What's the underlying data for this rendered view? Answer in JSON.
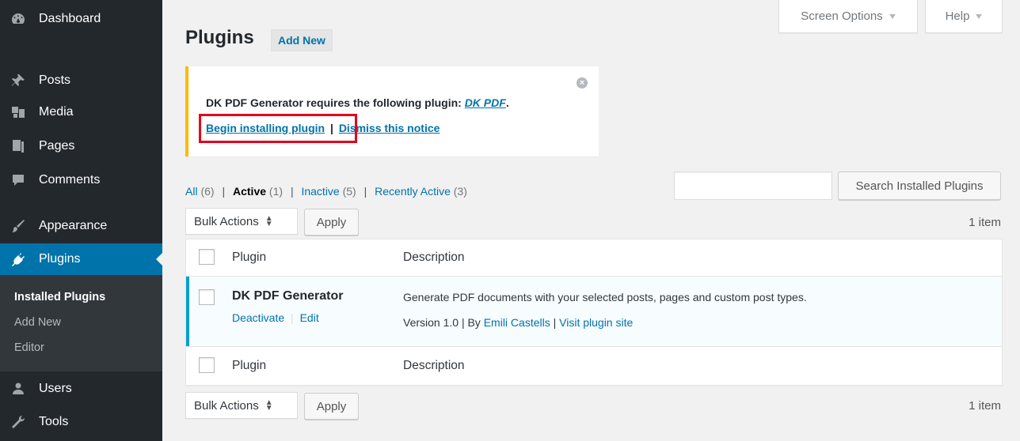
{
  "sidebar": {
    "items": [
      {
        "label": "Dashboard",
        "icon": "dashboard-icon"
      },
      {
        "label": "Posts",
        "icon": "pin-icon"
      },
      {
        "label": "Media",
        "icon": "media-icon"
      },
      {
        "label": "Pages",
        "icon": "pages-icon"
      },
      {
        "label": "Comments",
        "icon": "comment-icon"
      },
      {
        "label": "Appearance",
        "icon": "brush-icon"
      },
      {
        "label": "Plugins",
        "icon": "plugin-icon"
      },
      {
        "label": "Users",
        "icon": "users-icon"
      },
      {
        "label": "Tools",
        "icon": "wrench-icon"
      }
    ],
    "submenu": [
      "Installed Plugins",
      "Add New",
      "Editor"
    ]
  },
  "top_buttons": {
    "screen_options": "Screen Options",
    "help": "Help"
  },
  "header": {
    "title": "Plugins",
    "add_new": "Add New"
  },
  "notice": {
    "text": "DK PDF Generator requires the following plugin: ",
    "plugin_link": "DK PDF",
    "period": ".",
    "install_link": "Begin installing plugin",
    "separator": "|",
    "dismiss_link": "Dismiss this notice",
    "highlight_color": "#e3001a",
    "border_color": "#ffb900"
  },
  "filters": {
    "all": {
      "label": "All",
      "count": "(6)"
    },
    "active": {
      "label": "Active",
      "count": "(1)"
    },
    "inactive": {
      "label": "Inactive",
      "count": "(5)"
    },
    "recent": {
      "label": "Recently Active",
      "count": "(3)"
    },
    "sep": "|"
  },
  "search": {
    "button": "Search Installed Plugins"
  },
  "bulk": {
    "label": "Bulk Actions",
    "apply": "Apply",
    "count": "1 item"
  },
  "table": {
    "headers": {
      "plugin": "Plugin",
      "description": "Description"
    },
    "rows": [
      {
        "name": "DK PDF Generator",
        "actions": {
          "deactivate": "Deactivate",
          "sep": "|",
          "edit": "Edit"
        },
        "description": "Generate PDF documents with your selected posts, pages and custom post types.",
        "meta": {
          "version": "Version 1.0 | By ",
          "author": "Emili Castells",
          "sep": " | ",
          "site": "Visit plugin site"
        }
      }
    ]
  },
  "colors": {
    "accent": "#0073aa",
    "sidebar": "#23282d",
    "active_row_border": "#00a0d2"
  }
}
